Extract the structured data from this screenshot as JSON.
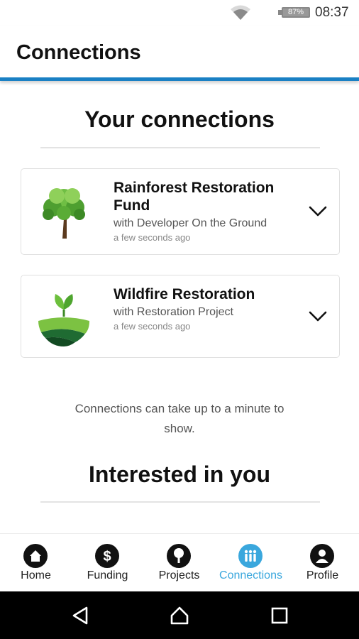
{
  "status_bar": {
    "battery": "87%",
    "time": "08:37"
  },
  "header": {
    "title": "Connections"
  },
  "connections_section": {
    "title": "Your connections"
  },
  "connections": [
    {
      "name": "Rainforest Restoration Fund",
      "partner": "with Developer On the Ground",
      "time": "a few seconds ago",
      "icon": "tree-icon"
    },
    {
      "name": "Wildfire Restoration",
      "partner": "with Restoration Project",
      "time": "a few seconds ago",
      "icon": "sprout-field-icon"
    }
  ],
  "info_text": "Connections can take up to a minute to show.",
  "interested_section": {
    "title": "Interested in you"
  },
  "bottom_nav": [
    {
      "label": "Home",
      "icon": "home-icon"
    },
    {
      "label": "Funding",
      "icon": "dollar-icon"
    },
    {
      "label": "Projects",
      "icon": "tree-icon"
    },
    {
      "label": "Connections",
      "icon": "people-icon",
      "active": true
    },
    {
      "label": "Profile",
      "icon": "person-icon"
    }
  ],
  "colors": {
    "accent": "#1a80c4",
    "active_nav": "#3aa7dd"
  }
}
